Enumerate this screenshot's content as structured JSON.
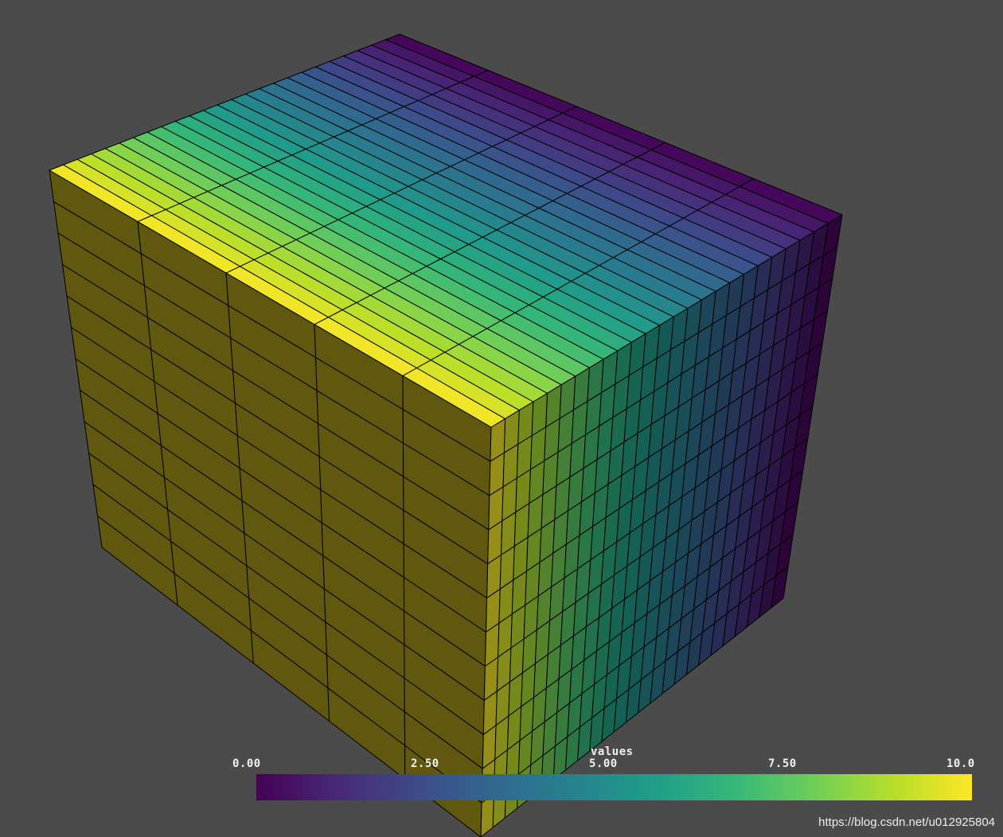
{
  "scene": {
    "background": "#4b4b4b",
    "colormap": "viridis",
    "colormap_stops": [
      "#440154",
      "#482878",
      "#3e4a89",
      "#31688e",
      "#26828e",
      "#1f9e89",
      "#35b779",
      "#6ece58",
      "#b5de2b",
      "#fde725"
    ],
    "edge_color": "#000000",
    "top_face_bands": 25,
    "top_face_rows": 5,
    "side_bands": 25,
    "front_columns": 5,
    "vertical_layers": 12
  },
  "colorbar": {
    "title": "values",
    "ticks": [
      "0.00",
      "2.50",
      "5.00",
      "7.50",
      "10.0"
    ],
    "range": [
      0,
      10
    ]
  },
  "watermark": {
    "text": "https://blog.csdn.net/u012925804"
  }
}
